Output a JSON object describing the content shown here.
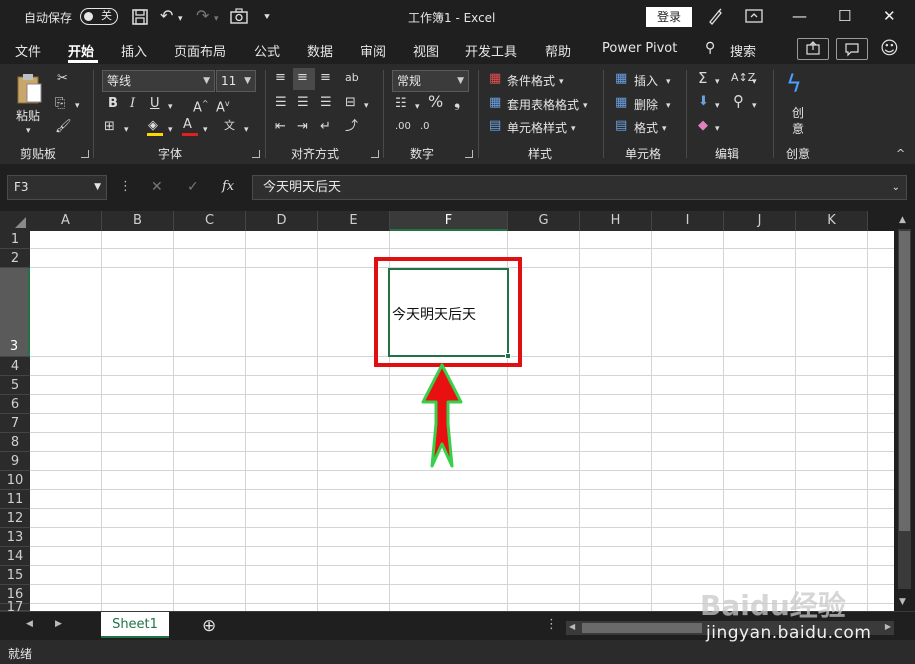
{
  "titlebar": {
    "autosave_label": "自动保存",
    "autosave_state": "关",
    "title": "工作簿1 - Excel",
    "login": "登录"
  },
  "tabs": [
    {
      "label": "文件"
    },
    {
      "label": "开始",
      "active": true
    },
    {
      "label": "插入"
    },
    {
      "label": "页面布局"
    },
    {
      "label": "公式"
    },
    {
      "label": "数据"
    },
    {
      "label": "审阅"
    },
    {
      "label": "视图"
    },
    {
      "label": "开发工具"
    },
    {
      "label": "帮助"
    },
    {
      "label": "Power Pivot"
    },
    {
      "label": "搜索"
    }
  ],
  "ribbon": {
    "clipboard": {
      "paste": "粘贴",
      "group": "剪贴板"
    },
    "font": {
      "name": "等线",
      "size": "11",
      "group": "字体"
    },
    "alignment": {
      "group": "对齐方式"
    },
    "number": {
      "format": "常规",
      "group": "数字"
    },
    "styles": {
      "conditional": "条件格式",
      "table": "套用表格格式",
      "cell": "单元格样式",
      "group": "样式"
    },
    "cells": {
      "insert": "插入",
      "delete": "删除",
      "format": "格式",
      "group": "单元格"
    },
    "editing": {
      "group": "编辑"
    },
    "create": {
      "label1": "创",
      "label2": "意",
      "group": "创意"
    }
  },
  "formula_bar": {
    "name_box": "F3",
    "fx": "fx",
    "content": "今天明天后天"
  },
  "grid": {
    "columns": [
      "A",
      "B",
      "C",
      "D",
      "E",
      "F",
      "G",
      "H",
      "I",
      "J",
      "K"
    ],
    "selected_column": "F",
    "rows": [
      "1",
      "2",
      "3",
      "4",
      "5",
      "6",
      "7",
      "8",
      "9",
      "10",
      "11",
      "12",
      "13",
      "14",
      "15",
      "16",
      "17"
    ],
    "selected_row": "3",
    "cell_F3": "今天明天后天"
  },
  "sheet_tabs": {
    "active": "Sheet1"
  },
  "status": {
    "text": "就绪"
  },
  "watermark": {
    "logo": "Baidu经验",
    "url": "jingyan.baidu.com"
  },
  "colors": {
    "excel_green": "#217346",
    "highlight_red": "#e01010",
    "arrow_fill": "#e81010",
    "arrow_stroke": "#36d04a"
  }
}
